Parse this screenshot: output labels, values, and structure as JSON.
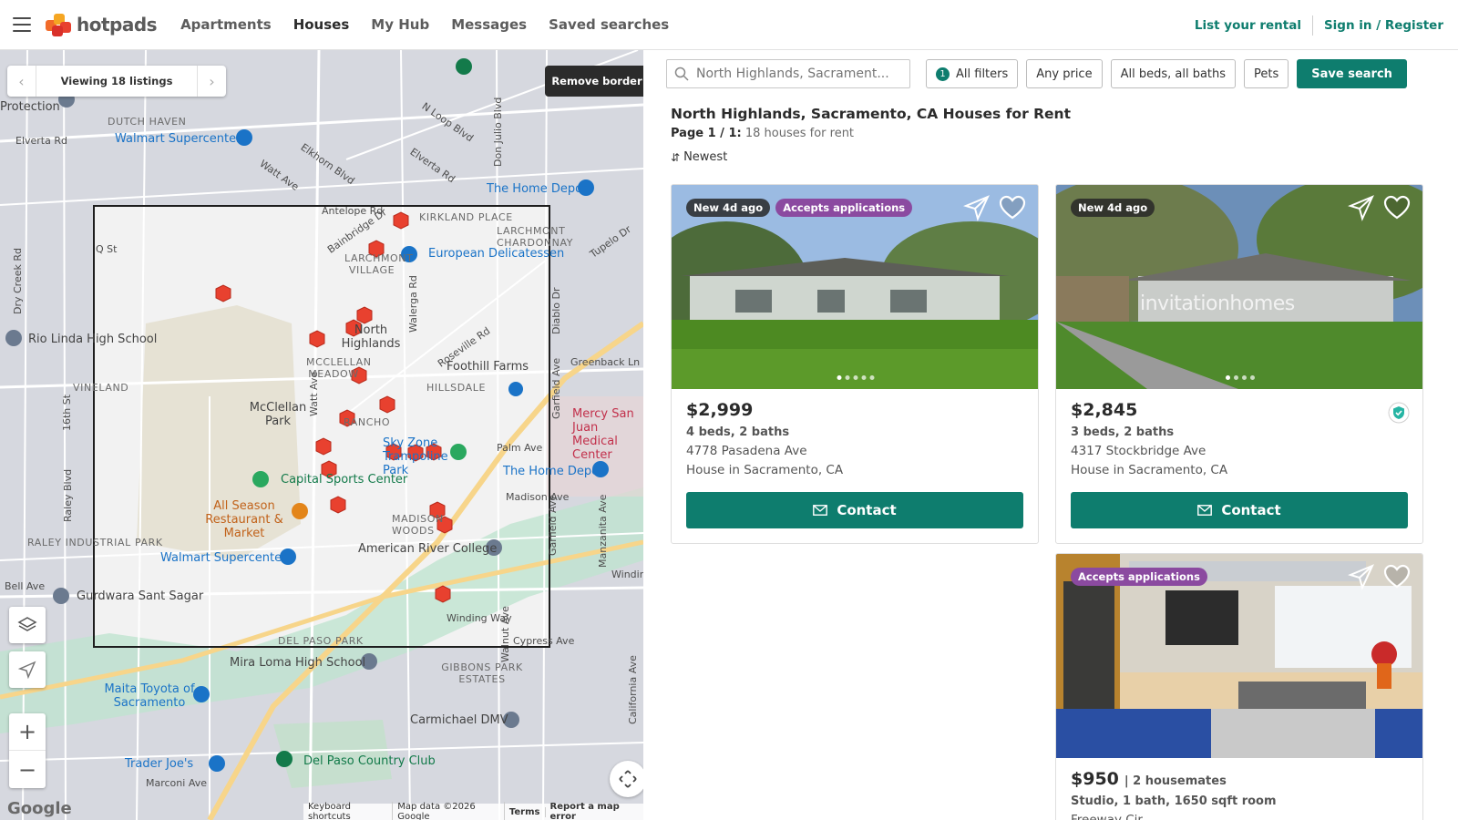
{
  "header": {
    "logo_text": "hotpads",
    "nav": [
      "Apartments",
      "Houses",
      "My Hub",
      "Messages",
      "Saved searches"
    ],
    "active_nav": "Houses",
    "list_rental": "List your rental",
    "sign_in": "Sign in / Register"
  },
  "map": {
    "viewing_label": "Viewing 18 listings",
    "remove_border_label": "Remove border",
    "google_label": "Google",
    "footer": {
      "shortcuts": "Keyboard shortcuts",
      "map_data": "Map data ©2026 Google",
      "terms": "Terms",
      "report": "Report a map error"
    },
    "labels": {
      "protection": "Protection",
      "dutch_haven": "DUTCH HAVEN",
      "elverta": "Elverta Rd",
      "walmart1": "Walmart Supercenter",
      "watt_ave": "Watt Ave",
      "elkhorn": "Elkhorn Blvd",
      "n_loop": "N Loop Blvd",
      "don_julio": "Don Julio Blvd",
      "elverta2": "Elverta Rd",
      "home_depot1": "The Home Depot",
      "antelope": "Antelope Rd",
      "kirkland": "KIRKLAND PLACE",
      "larchmont_ch": "LARCHMONT CHARDONNAY",
      "bainbridge": "Bainbridge Dr",
      "q_st": "Q St",
      "larchmont_v": "LARCHMONT VILLAGE",
      "european": "European Delicatessen",
      "tupelo": "Tupelo Dr",
      "dry_creek": "Dry Creek Rd",
      "rio_linda": "Rio Linda High School",
      "north_highlands": "North Highlands",
      "walerga": "Walerga Rd",
      "roseville": "Roseville Rd",
      "diablo": "Diablo Dr",
      "foothill": "Foothill Farms",
      "mcclellan_meadow": "MCCLELLAN MEADOW",
      "greenback": "Greenback Ln",
      "vineland": "VINELAND",
      "hillsdale": "HILLSDALE",
      "watt_ave2": "Watt Ave",
      "mcclellan_park": "McClellan Park",
      "rancho": "RANCHO",
      "street_16": "16th St",
      "garfield": "Garfield Ave",
      "mercy": "Mercy San Juan Medical Center",
      "sky_zone": "Sky Zone Trampoline Park",
      "palm": "Palm Ave",
      "home_depot2": "The Home Depot",
      "capital": "Capital Sports Center",
      "raley": "Raley Blvd",
      "all_season": "All Season Restaurant & Market",
      "madison": "Madison Ave",
      "madison_woods": "MADISON WOODS",
      "garfield2": "Garfield Ave",
      "raley_ind": "RALEY INDUSTRIAL PARK",
      "walmart2": "Walmart Supercenter",
      "arc": "American River College",
      "manzanita": "Manzanita Ave",
      "winding": "Winding Way",
      "bell": "Bell Ave",
      "gurdwara": "Gurdwara Sant Sagar",
      "winding2": "Winding Way",
      "walnut": "Walnut Ave",
      "cypress": "Cypress Ave",
      "del_paso": "DEL PASO PARK",
      "mira_loma": "Mira Loma High School",
      "gibbons": "GIBBONS PARK ESTATES",
      "maita": "Maita Toyota of Sacramento",
      "carmichael": "Carmichael DMV",
      "california": "California Ave",
      "trader": "Trader Joe's",
      "del_paso_cc": "Del Paso Country Club",
      "marconi": "Marconi Ave"
    }
  },
  "filters": {
    "search_placeholder": "North Highlands, Sacrament...",
    "all_filters_count": "1",
    "all_filters": "All filters",
    "price": "Any price",
    "beds": "All beds, all baths",
    "pets": "Pets",
    "save_search": "Save search"
  },
  "results": {
    "title": "North Highlands, Sacramento, CA Houses for Rent",
    "page_label": "Page 1 / 1:",
    "count_label": "18 houses for rent",
    "sort": "Newest"
  },
  "listings": [
    {
      "tags": [
        "New 4d ago",
        "Accepts applications"
      ],
      "price": "$2,999",
      "beds": "4 beds, 2 baths",
      "address": "4778 Pasadena Ave",
      "type": "House in Sacramento, CA",
      "contact": "Contact"
    },
    {
      "tags": [
        "New 4d ago"
      ],
      "watermark": "invitationhomes",
      "price": "$2,845",
      "beds": "3 beds, 2 baths",
      "address": "4317 Stockbridge Ave",
      "type": "House in Sacramento, CA",
      "contact": "Contact"
    },
    {
      "tags": [
        "Accepts applications"
      ],
      "price": "$950",
      "price_sub": "| 2 housemates",
      "beds": "Studio, 1 bath, 1650 sqft room",
      "address": "Freeway Cir"
    }
  ],
  "colors": {
    "brand": "#0e7d6e",
    "pin": "#e8412f",
    "tag_purple": "#8b4aa0"
  }
}
